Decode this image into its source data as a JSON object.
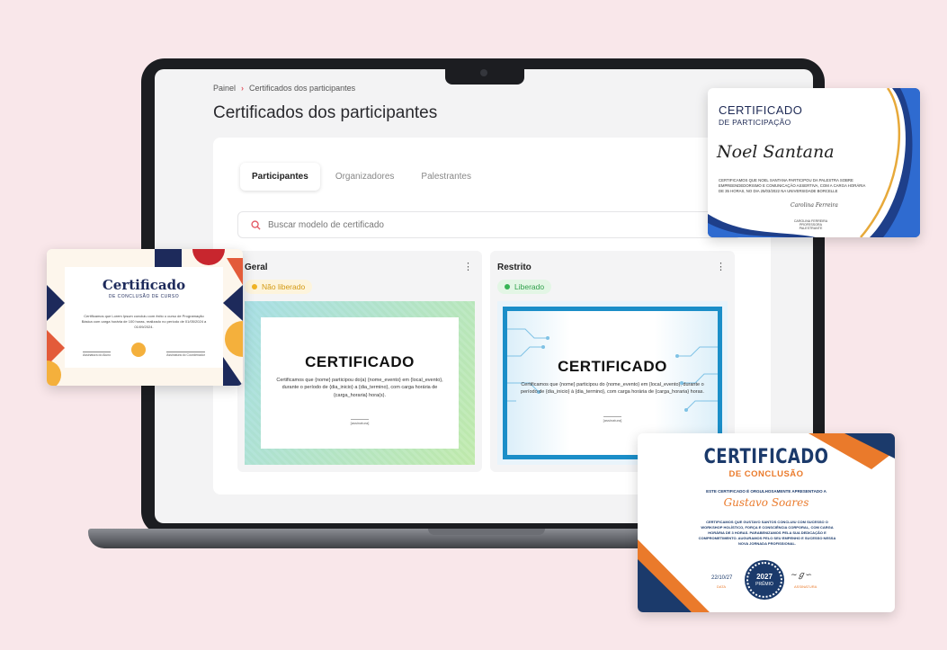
{
  "breadcrumb": {
    "root": "Painel",
    "current": "Certificados dos participantes"
  },
  "page": {
    "title": "Certificados dos participantes"
  },
  "tabs": [
    {
      "label": "Participantes",
      "active": true
    },
    {
      "label": "Organizadores",
      "active": false
    },
    {
      "label": "Palestrantes",
      "active": false
    }
  ],
  "search": {
    "placeholder": "Buscar modelo de certificado"
  },
  "cards": [
    {
      "title": "Geral",
      "status": "Não liberado",
      "status_color": "#f0b323",
      "preview": {
        "heading": "CERTIFICADO",
        "text": "Certificamos que {nome} participou do(a) {nome_evento} em {local_evento}, durante o período de {dia_inicio} a {dia_termino}, com carga horária de {carga_horaria} hora(s).",
        "signature": "[assinatura]"
      }
    },
    {
      "title": "Restrito",
      "status": "Liberado",
      "status_color": "#36b454",
      "preview": {
        "heading": "CERTIFICADO",
        "text": "Certificamos que {nome} participou do {nome_evento} em {local_evento}, durante o período de {dia_inicio} à {dia_termino}, com carga horária de {carga_horaria} horas.",
        "signature": "[assinatura]"
      }
    }
  ],
  "floating": {
    "conclusao_curso": {
      "title": "Certificado",
      "subtitle": "DE CONCLUSÃO DE CURSO",
      "body": "Certificamos que Lorem Ipsum concluiu com êxito o curso de Programação Básica com carga horária de 100 horas, realizado no período de 01/05/2024 a 01/09/2024.",
      "sign_left": "Assinatura do Aluno",
      "sign_right": "Assinatura do Coordenador"
    },
    "participacao": {
      "title": "CERTIFICADO",
      "subtitle": "DE PARTICIPAÇÃO",
      "name": "Noel Santana",
      "body": "CERTIFICAMOS QUE NOEL SANTANA PARTICIPOU DA PALESTRA SOBRE EMPREENDEDORISMO E COMUNICAÇÃO ASSERTIVA, COM A CARGA HORÁRIA DE 35 HORAS, NO DIA 25/03/2022 NA UNIVERSIDADE BORCELLE",
      "sign": "Carolina Ferreira",
      "role": "CAROLINA FERREIRA PROFESSORA PALESTRANTE"
    },
    "conclusao": {
      "title": "CERTIFICADO",
      "subtitle": "DE CONCLUSÃO",
      "lead": "ESTE CERTIFICADO É ORGULHOSAMENTE APRESENTADO A",
      "name": "Gustavo Soares",
      "body": "CERTIFICAMOS QUE GUSTAVO SANTOS CONCLUIU COM SUCESSO O WORKSHOP HOLÍSTICO, FORÇA E CONSCIÊNCIA CORPORAL, COM CARGA HORÁRIA DE 3 HORAS. PARABENIZAMOS PELA SUA DEDICAÇÃO E COMPROMETIMENTO. AUGURAMOS PELO SEU EMPENHO E SUCESSO NESSA NOVA JORNADA PROFISSIONAL.",
      "date": "22/10/27",
      "date_label": "DATA",
      "seal_year": "2027",
      "seal_label": "PRÊMIO",
      "sign_label": "ASSINATURA"
    }
  },
  "colors": {
    "background": "#f9e7ea",
    "accent_red": "#e35b66",
    "navy": "#1b3a6b",
    "orange": "#ea7a2b",
    "blue_frame": "#1b8ec8"
  }
}
